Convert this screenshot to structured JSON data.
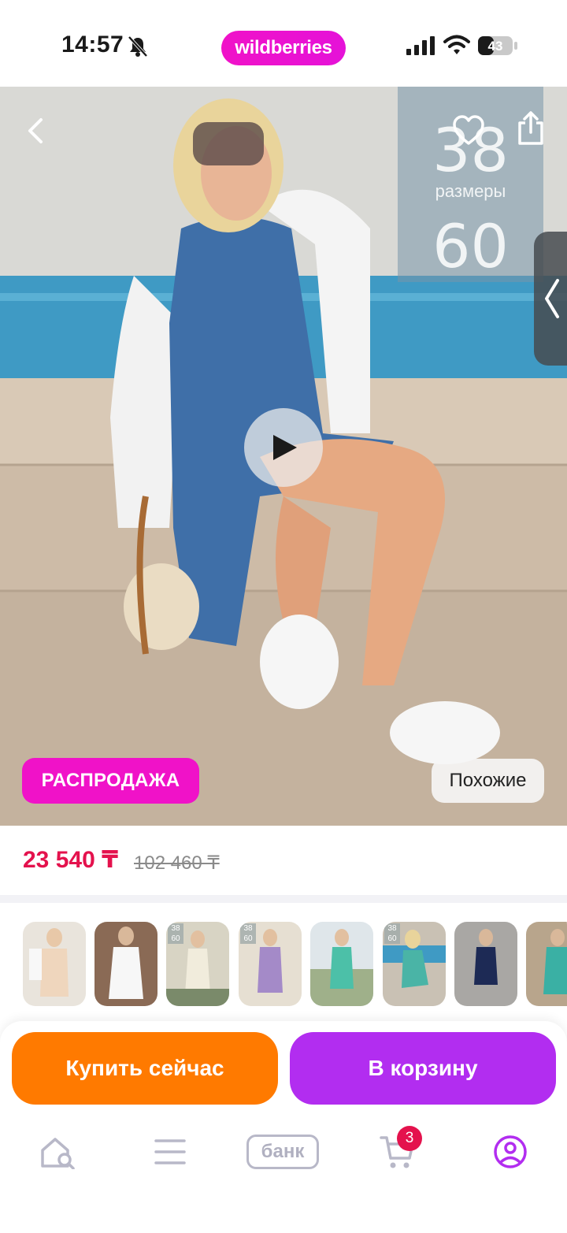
{
  "status_bar": {
    "time": "14:57",
    "brand": "wildberries",
    "battery": "43",
    "icons": [
      "bell-off-icon",
      "signal-icon",
      "wifi-icon",
      "battery-icon"
    ]
  },
  "product_image": {
    "size_overlay": {
      "from": "38",
      "label": "размеры",
      "to": "60"
    },
    "sale_badge": "РАСПРОДАЖА",
    "similar_button": "Похожие",
    "icons": [
      "back-icon",
      "heart-icon",
      "share-icon",
      "play-icon",
      "side-tab-chevron-icon"
    ]
  },
  "price": {
    "current": "23 540 ₸",
    "old": "102 460 ₸"
  },
  "thumbnails": [
    {
      "badge_from": "",
      "badge_to": ""
    },
    {
      "badge_from": "",
      "badge_to": ""
    },
    {
      "badge_from": "38",
      "badge_to": "60"
    },
    {
      "badge_from": "38",
      "badge_to": "60"
    },
    {
      "badge_from": "",
      "badge_to": ""
    },
    {
      "badge_from": "38",
      "badge_to": "60"
    },
    {
      "badge_from": "",
      "badge_to": ""
    },
    {
      "badge_from": "",
      "badge_to": ""
    }
  ],
  "actions": {
    "buy_now": "Купить сейчас",
    "add_to_cart": "В корзину"
  },
  "bottom_nav": {
    "items": [
      "home-search-icon",
      "catalog-icon",
      "bank-icon",
      "cart-icon",
      "profile-icon"
    ],
    "bank_label": "банк",
    "cart_count": "3"
  },
  "colors": {
    "brand": "#f012c8",
    "price": "#e4124d",
    "buy_now": "#ff7a00",
    "add_to_cart": "#b22df0",
    "nav_active": "#b22df0"
  }
}
